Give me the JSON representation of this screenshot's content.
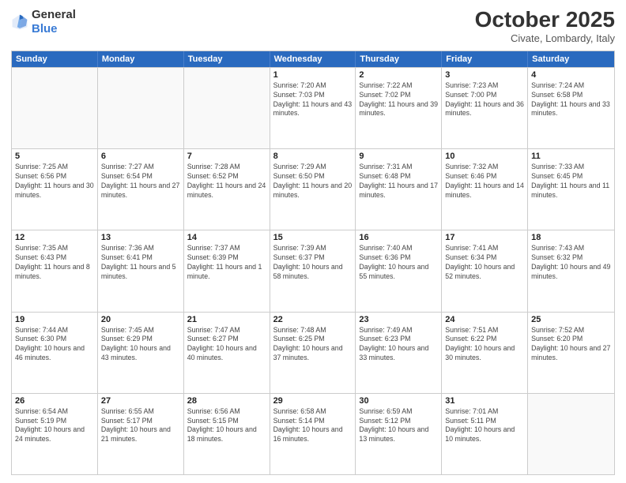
{
  "header": {
    "logo_general": "General",
    "logo_blue": "Blue",
    "title": "October 2025",
    "location": "Civate, Lombardy, Italy"
  },
  "days_of_week": [
    "Sunday",
    "Monday",
    "Tuesday",
    "Wednesday",
    "Thursday",
    "Friday",
    "Saturday"
  ],
  "weeks": [
    [
      {
        "day": "",
        "sunrise": "",
        "sunset": "",
        "daylight": ""
      },
      {
        "day": "",
        "sunrise": "",
        "sunset": "",
        "daylight": ""
      },
      {
        "day": "",
        "sunrise": "",
        "sunset": "",
        "daylight": ""
      },
      {
        "day": "1",
        "sunrise": "Sunrise: 7:20 AM",
        "sunset": "Sunset: 7:03 PM",
        "daylight": "Daylight: 11 hours and 43 minutes."
      },
      {
        "day": "2",
        "sunrise": "Sunrise: 7:22 AM",
        "sunset": "Sunset: 7:02 PM",
        "daylight": "Daylight: 11 hours and 39 minutes."
      },
      {
        "day": "3",
        "sunrise": "Sunrise: 7:23 AM",
        "sunset": "Sunset: 7:00 PM",
        "daylight": "Daylight: 11 hours and 36 minutes."
      },
      {
        "day": "4",
        "sunrise": "Sunrise: 7:24 AM",
        "sunset": "Sunset: 6:58 PM",
        "daylight": "Daylight: 11 hours and 33 minutes."
      }
    ],
    [
      {
        "day": "5",
        "sunrise": "Sunrise: 7:25 AM",
        "sunset": "Sunset: 6:56 PM",
        "daylight": "Daylight: 11 hours and 30 minutes."
      },
      {
        "day": "6",
        "sunrise": "Sunrise: 7:27 AM",
        "sunset": "Sunset: 6:54 PM",
        "daylight": "Daylight: 11 hours and 27 minutes."
      },
      {
        "day": "7",
        "sunrise": "Sunrise: 7:28 AM",
        "sunset": "Sunset: 6:52 PM",
        "daylight": "Daylight: 11 hours and 24 minutes."
      },
      {
        "day": "8",
        "sunrise": "Sunrise: 7:29 AM",
        "sunset": "Sunset: 6:50 PM",
        "daylight": "Daylight: 11 hours and 20 minutes."
      },
      {
        "day": "9",
        "sunrise": "Sunrise: 7:31 AM",
        "sunset": "Sunset: 6:48 PM",
        "daylight": "Daylight: 11 hours and 17 minutes."
      },
      {
        "day": "10",
        "sunrise": "Sunrise: 7:32 AM",
        "sunset": "Sunset: 6:46 PM",
        "daylight": "Daylight: 11 hours and 14 minutes."
      },
      {
        "day": "11",
        "sunrise": "Sunrise: 7:33 AM",
        "sunset": "Sunset: 6:45 PM",
        "daylight": "Daylight: 11 hours and 11 minutes."
      }
    ],
    [
      {
        "day": "12",
        "sunrise": "Sunrise: 7:35 AM",
        "sunset": "Sunset: 6:43 PM",
        "daylight": "Daylight: 11 hours and 8 minutes."
      },
      {
        "day": "13",
        "sunrise": "Sunrise: 7:36 AM",
        "sunset": "Sunset: 6:41 PM",
        "daylight": "Daylight: 11 hours and 5 minutes."
      },
      {
        "day": "14",
        "sunrise": "Sunrise: 7:37 AM",
        "sunset": "Sunset: 6:39 PM",
        "daylight": "Daylight: 11 hours and 1 minute."
      },
      {
        "day": "15",
        "sunrise": "Sunrise: 7:39 AM",
        "sunset": "Sunset: 6:37 PM",
        "daylight": "Daylight: 10 hours and 58 minutes."
      },
      {
        "day": "16",
        "sunrise": "Sunrise: 7:40 AM",
        "sunset": "Sunset: 6:36 PM",
        "daylight": "Daylight: 10 hours and 55 minutes."
      },
      {
        "day": "17",
        "sunrise": "Sunrise: 7:41 AM",
        "sunset": "Sunset: 6:34 PM",
        "daylight": "Daylight: 10 hours and 52 minutes."
      },
      {
        "day": "18",
        "sunrise": "Sunrise: 7:43 AM",
        "sunset": "Sunset: 6:32 PM",
        "daylight": "Daylight: 10 hours and 49 minutes."
      }
    ],
    [
      {
        "day": "19",
        "sunrise": "Sunrise: 7:44 AM",
        "sunset": "Sunset: 6:30 PM",
        "daylight": "Daylight: 10 hours and 46 minutes."
      },
      {
        "day": "20",
        "sunrise": "Sunrise: 7:45 AM",
        "sunset": "Sunset: 6:29 PM",
        "daylight": "Daylight: 10 hours and 43 minutes."
      },
      {
        "day": "21",
        "sunrise": "Sunrise: 7:47 AM",
        "sunset": "Sunset: 6:27 PM",
        "daylight": "Daylight: 10 hours and 40 minutes."
      },
      {
        "day": "22",
        "sunrise": "Sunrise: 7:48 AM",
        "sunset": "Sunset: 6:25 PM",
        "daylight": "Daylight: 10 hours and 37 minutes."
      },
      {
        "day": "23",
        "sunrise": "Sunrise: 7:49 AM",
        "sunset": "Sunset: 6:23 PM",
        "daylight": "Daylight: 10 hours and 33 minutes."
      },
      {
        "day": "24",
        "sunrise": "Sunrise: 7:51 AM",
        "sunset": "Sunset: 6:22 PM",
        "daylight": "Daylight: 10 hours and 30 minutes."
      },
      {
        "day": "25",
        "sunrise": "Sunrise: 7:52 AM",
        "sunset": "Sunset: 6:20 PM",
        "daylight": "Daylight: 10 hours and 27 minutes."
      }
    ],
    [
      {
        "day": "26",
        "sunrise": "Sunrise: 6:54 AM",
        "sunset": "Sunset: 5:19 PM",
        "daylight": "Daylight: 10 hours and 24 minutes."
      },
      {
        "day": "27",
        "sunrise": "Sunrise: 6:55 AM",
        "sunset": "Sunset: 5:17 PM",
        "daylight": "Daylight: 10 hours and 21 minutes."
      },
      {
        "day": "28",
        "sunrise": "Sunrise: 6:56 AM",
        "sunset": "Sunset: 5:15 PM",
        "daylight": "Daylight: 10 hours and 18 minutes."
      },
      {
        "day": "29",
        "sunrise": "Sunrise: 6:58 AM",
        "sunset": "Sunset: 5:14 PM",
        "daylight": "Daylight: 10 hours and 16 minutes."
      },
      {
        "day": "30",
        "sunrise": "Sunrise: 6:59 AM",
        "sunset": "Sunset: 5:12 PM",
        "daylight": "Daylight: 10 hours and 13 minutes."
      },
      {
        "day": "31",
        "sunrise": "Sunrise: 7:01 AM",
        "sunset": "Sunset: 5:11 PM",
        "daylight": "Daylight: 10 hours and 10 minutes."
      },
      {
        "day": "",
        "sunrise": "",
        "sunset": "",
        "daylight": ""
      }
    ]
  ]
}
